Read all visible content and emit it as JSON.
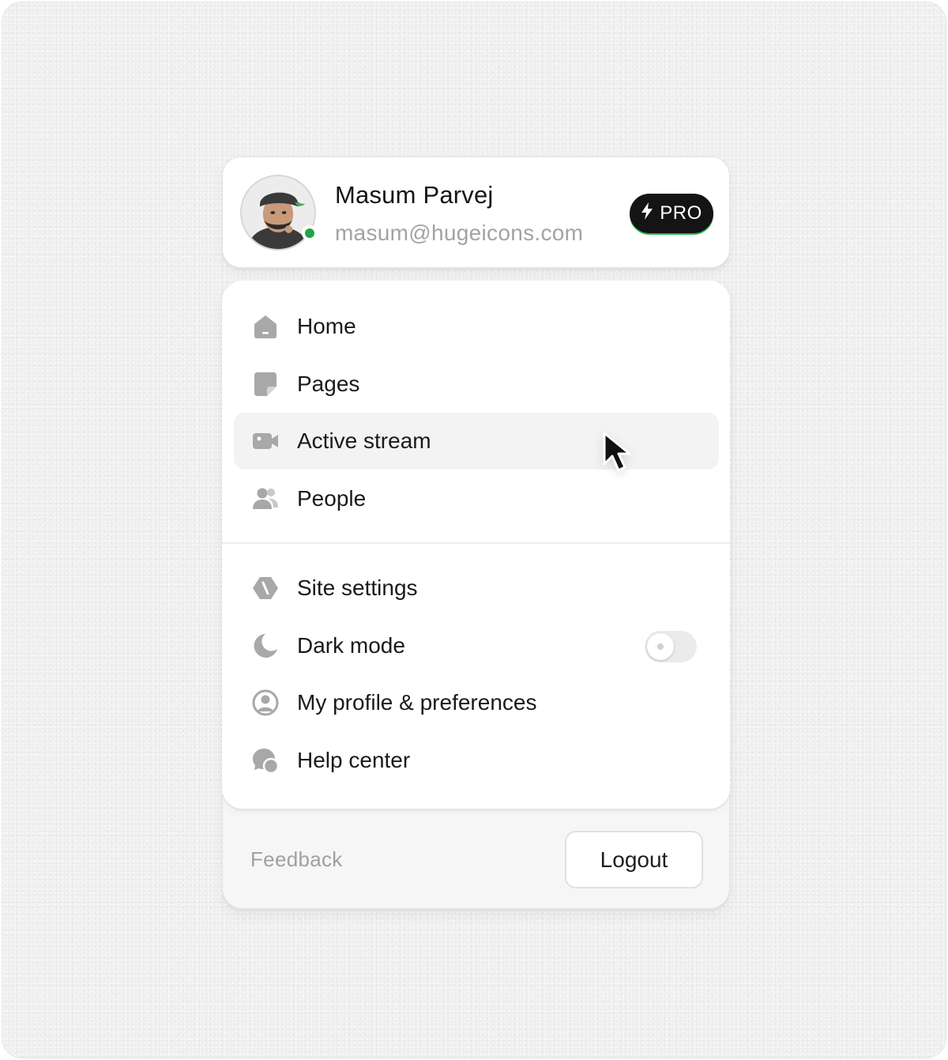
{
  "profile": {
    "name": "Masum Parvej",
    "email": "masum@hugeicons.com",
    "status": "online",
    "badge": {
      "icon": "lightning-icon",
      "label": "PRO",
      "accent": "#2bb34f"
    }
  },
  "menu": {
    "primary": [
      {
        "icon": "home-icon",
        "label": "Home"
      },
      {
        "icon": "pages-icon",
        "label": "Pages"
      },
      {
        "icon": "video-camera-icon",
        "label": "Active stream",
        "active": true
      },
      {
        "icon": "people-icon",
        "label": "People"
      }
    ],
    "secondary": [
      {
        "icon": "site-settings-icon",
        "label": "Site settings"
      },
      {
        "icon": "moon-icon",
        "label": "Dark mode",
        "toggle": false
      },
      {
        "icon": "user-circle-icon",
        "label": "My profile & preferences"
      },
      {
        "icon": "help-chat-icon",
        "label": "Help center"
      }
    ]
  },
  "footer": {
    "feedback_label": "Feedback",
    "logout_label": "Logout"
  },
  "colors": {
    "status_online": "#22a44a",
    "badge_bg": "#141414",
    "icon_gray": "#a8a8a8",
    "active_row": "#f3f3f3"
  }
}
